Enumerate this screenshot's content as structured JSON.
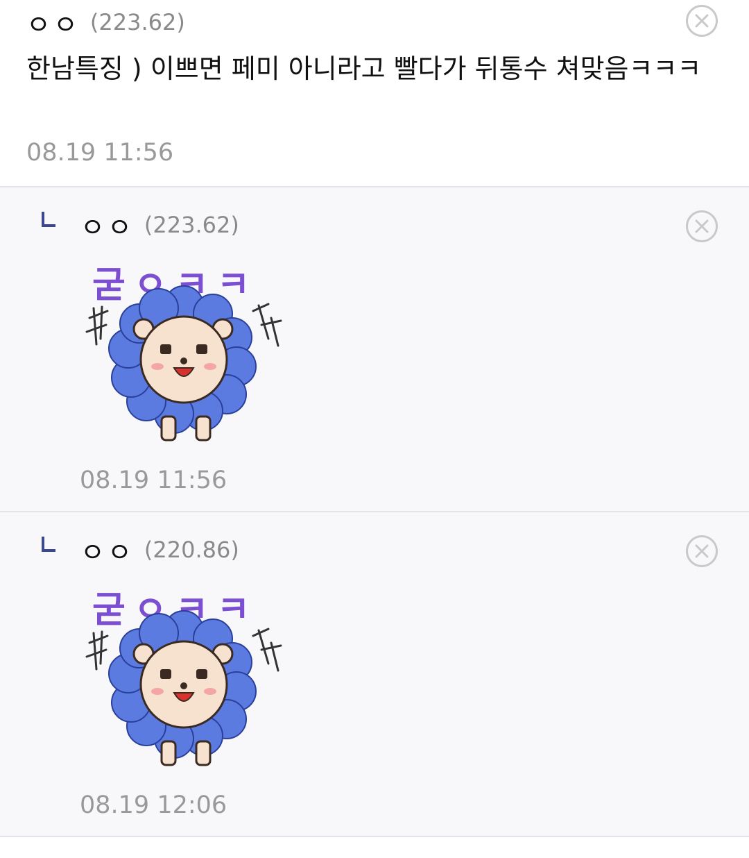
{
  "comments": [
    {
      "nick": "ㅇㅇ",
      "ip": "(223.62)",
      "text": "한남특징 ) 이쁘면 페미 아니라고 빨다가 뒤통수 쳐맞음ㅋㅋㅋ",
      "time": "08.19 11:56"
    },
    {
      "nick": "ㅇㅇ",
      "ip": "(223.62)",
      "sticker_text": "굳ㅇㅋㅋ",
      "time": "08.19 11:56"
    },
    {
      "nick": "ㅇㅇ",
      "ip": "(220.86)",
      "sticker_text": "굳ㅇㅋㅋ",
      "time": "08.19 12:06"
    }
  ],
  "colors": {
    "reply_bg": "#f8f8fa",
    "divider": "#e3e4ea",
    "reply_mark": "#3b4890",
    "sticker_text": "#7b4fd0",
    "mane": "#5b7be0"
  },
  "icons": {
    "delete": "close-circle-icon",
    "reply": "reply-corner-icon"
  }
}
